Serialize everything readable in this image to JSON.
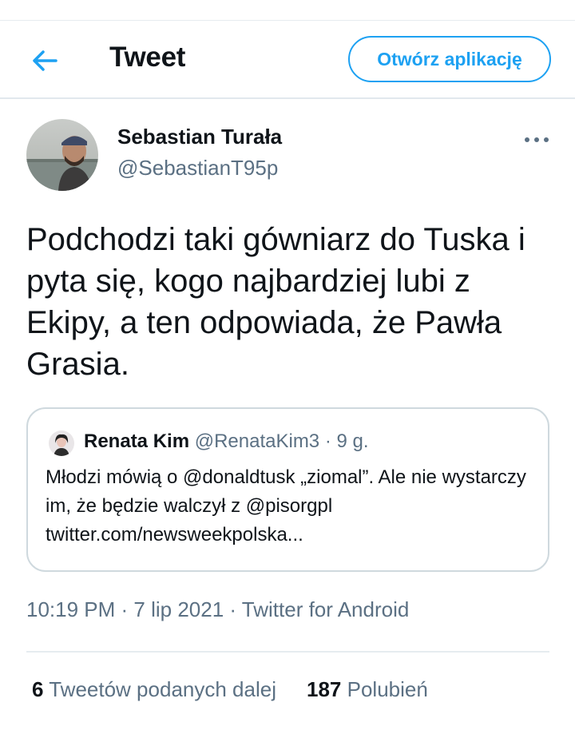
{
  "header": {
    "title": "Tweet",
    "open_app_label": "Otwórz aplikację",
    "back_icon": "arrow-left-icon"
  },
  "tweet": {
    "author": {
      "name": "Sebastian Turała",
      "handle": "@SebastianT95p"
    },
    "more_icon": "more-horizontal-icon",
    "text": "Podchodzi taki gówniarz do Tuska i pyta się, kogo najbardziej lubi z Ekipy, a ten odpowiada, że Pawła Grasia.",
    "quoted": {
      "name": "Renata Kim",
      "handle": "@RenataKim3",
      "separator": " · ",
      "age": "9 g.",
      "text": "Młodzi mówią o @donaldtusk „ziomal”. Ale nie wystarczy im, że będzie walczył z @pisorgpl twitter.com/newsweekpolska..."
    },
    "timestamp": "10:19 PM · 7 lip 2021 · Twitter for Android",
    "stats": {
      "retweets_count": "6",
      "retweets_label": "Tweetów podanych dalej",
      "likes_count": "187",
      "likes_label": "Polubień"
    }
  },
  "colors": {
    "accent": "#1da1f2",
    "text_primary": "#0f1419",
    "text_secondary": "#5b7083",
    "border": "#cfd9de"
  }
}
